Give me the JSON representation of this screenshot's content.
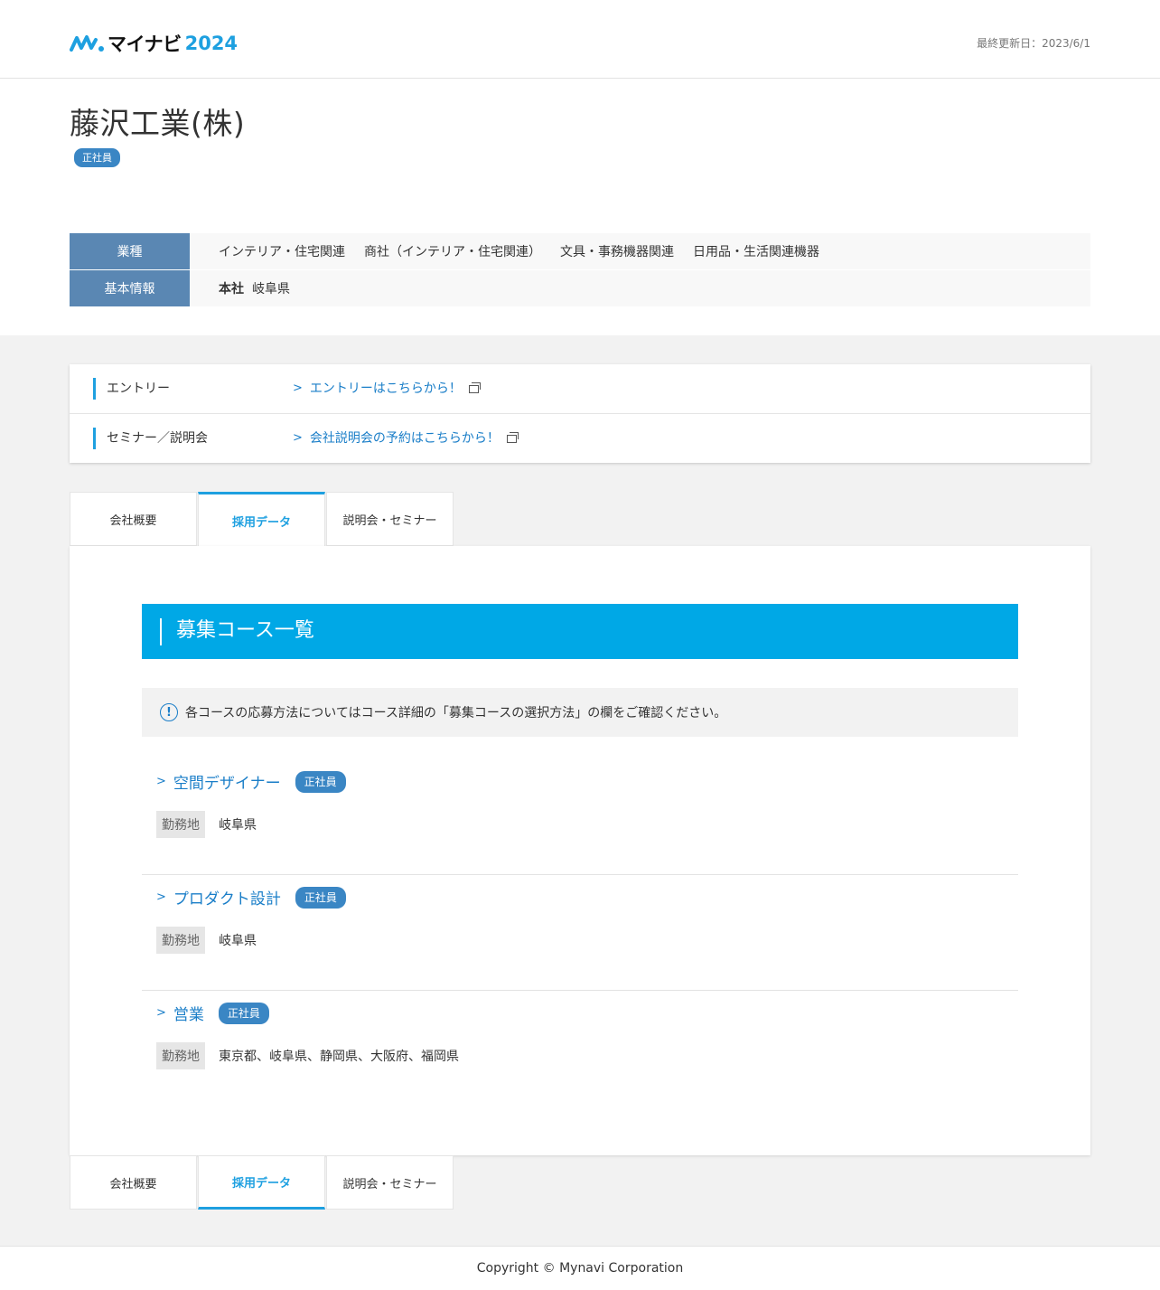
{
  "header": {
    "logo_text": "マイナビ",
    "logo_year": "2024",
    "updated": "最終更新日：2023/6/1"
  },
  "company": {
    "name": "藤沢工業(株)",
    "employment_badge": "正社員"
  },
  "info": {
    "industry_label": "業種",
    "industries": [
      "インテリア・住宅関連",
      "商社（インテリア・住宅関連）",
      "文具・事務機器関連",
      "日用品・生活関連機器"
    ],
    "basic_label": "基本情報",
    "hq_label": "本社",
    "hq_value": "岐阜県"
  },
  "entry": {
    "rows": [
      {
        "label": "エントリー",
        "link": "エントリーはこちらから！"
      },
      {
        "label": "セミナー／説明会",
        "link": "会社説明会の予約はこちらから！"
      }
    ]
  },
  "tabs": [
    {
      "label": "会社概要",
      "active": false
    },
    {
      "label": "採用データ",
      "active": true
    },
    {
      "label": "説明会・セミナー",
      "active": false
    }
  ],
  "courses_section": {
    "title": "募集コース一覧",
    "notice": "各コースの応募方法についてはコース詳細の「募集コースの選択方法」の欄をご確認ください。",
    "location_label": "勤務地",
    "courses": [
      {
        "name": "空間デザイナー",
        "badge": "正社員",
        "location": "岐阜県"
      },
      {
        "name": "プロダクト設計",
        "badge": "正社員",
        "location": "岐阜県"
      },
      {
        "name": "営業",
        "badge": "正社員",
        "location": "東京都、岐阜県、静岡県、大阪府、福岡県"
      }
    ]
  },
  "footer": {
    "copyright": "Copyright © Mynavi Corporation"
  },
  "colors": {
    "accent": "#1ea0e0",
    "section_head": "#00a8e6",
    "badge": "#3a86c4",
    "table_head": "#5a87b3",
    "link": "#1a7ec8"
  },
  "icons": [
    "mynavi-logo-icon",
    "external-window-icon",
    "chevron-right-icon",
    "info-icon"
  ]
}
